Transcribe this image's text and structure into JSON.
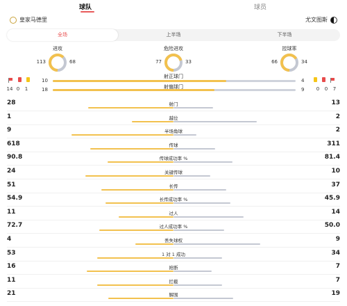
{
  "tabs": [
    {
      "label": "球队",
      "active": true
    },
    {
      "label": "球员",
      "active": false
    }
  ],
  "teams": {
    "home": "皇家马德里",
    "away": "尤文图斯"
  },
  "periods": [
    {
      "label": "全场",
      "active": true
    },
    {
      "label": "上半场",
      "active": false
    },
    {
      "label": "下半场",
      "active": false
    }
  ],
  "rings": [
    {
      "label": "进攻",
      "home": "113",
      "away": "68",
      "home_value": 113,
      "away_value": 68
    },
    {
      "label": "危险进攻",
      "home": "77",
      "away": "33",
      "home_value": 77,
      "away_value": 33
    },
    {
      "label": "控球率",
      "home": "66",
      "away": "34",
      "home_value": 66,
      "away_value": 34
    }
  ],
  "shots": {
    "on_target": {
      "label": "射正球门",
      "home": "10",
      "away": "4",
      "home_value": 10,
      "away_value": 4
    },
    "off_target": {
      "label": "射偏球门",
      "home": "18",
      "away": "9",
      "home_value": 18,
      "away_value": 9
    }
  },
  "cards": {
    "home": {
      "corners": "14",
      "red": "0",
      "yellow": "1"
    },
    "away": {
      "yellow": "0",
      "red": "0",
      "corners": "7"
    }
  },
  "colors": {
    "home": "#f2c14e",
    "away": "#c4c8d2",
    "accent": "#e84b4b"
  },
  "stats": [
    {
      "label": "射门",
      "home": "28",
      "away": "13",
      "home_value": 28,
      "away_value": 13
    },
    {
      "label": "越位",
      "home": "1",
      "away": "2",
      "home_value": 1,
      "away_value": 2
    },
    {
      "label": "半场角球",
      "home": "9",
      "away": "2",
      "home_value": 9,
      "away_value": 2
    },
    {
      "label": "传球",
      "home": "618",
      "away": "311",
      "home_value": 618,
      "away_value": 311
    },
    {
      "label": "传球成功率 %",
      "home": "90.8",
      "away": "81.4",
      "home_value": 90.8,
      "away_value": 81.4
    },
    {
      "label": "关键传球",
      "home": "24",
      "away": "10",
      "home_value": 24,
      "away_value": 10
    },
    {
      "label": "长传",
      "home": "51",
      "away": "37",
      "home_value": 51,
      "away_value": 37
    },
    {
      "label": "长传成功率 %",
      "home": "54.9",
      "away": "45.9",
      "home_value": 54.9,
      "away_value": 45.9
    },
    {
      "label": "过人",
      "home": "11",
      "away": "14",
      "home_value": 11,
      "away_value": 14
    },
    {
      "label": "过人成功率 %",
      "home": "72.7",
      "away": "50.0",
      "home_value": 72.7,
      "away_value": 50.0
    },
    {
      "label": "丢失球权",
      "home": "4",
      "away": "9",
      "home_value": 4,
      "away_value": 9
    },
    {
      "label": "1 对 1 成功",
      "home": "53",
      "away": "34",
      "home_value": 53,
      "away_value": 34
    },
    {
      "label": "抢断",
      "home": "16",
      "away": "7",
      "home_value": 16,
      "away_value": 7
    },
    {
      "label": "拦截",
      "home": "11",
      "away": "7",
      "home_value": 11,
      "away_value": 7
    },
    {
      "label": "解围",
      "home": "21",
      "away": "19",
      "home_value": 21,
      "away_value": 19
    }
  ]
}
